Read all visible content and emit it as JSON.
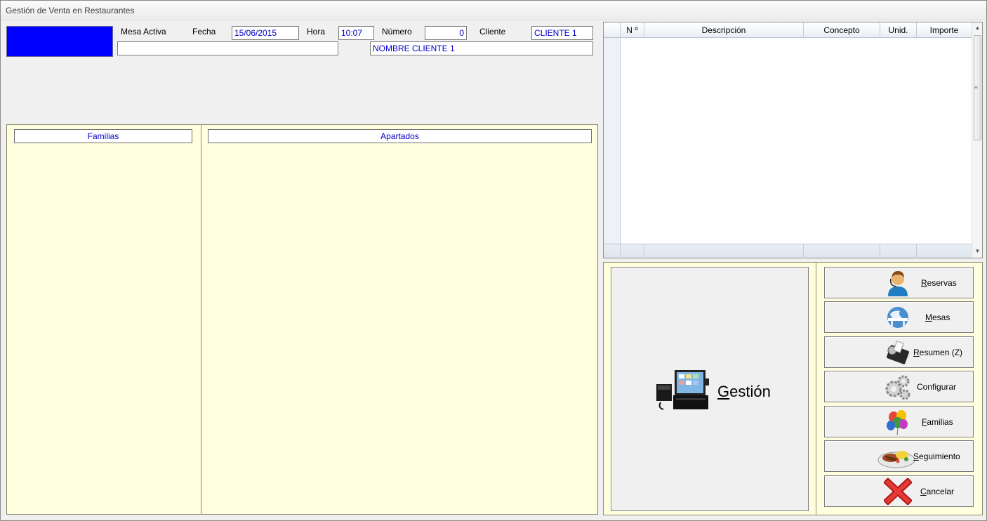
{
  "window": {
    "title": "Gestión de Venta en Restaurantes"
  },
  "colors": {
    "accent": "#0000ff",
    "panel_bg": "#ffffe0",
    "field_text": "#0000cc"
  },
  "header": {
    "mesa_activa_label": "Mesa Activa",
    "mesa_activa_value": "",
    "fecha_label": "Fecha",
    "fecha_value": "15/06/2015",
    "hora_label": "Hora",
    "hora_value": "10:07",
    "numero_label": "Número",
    "numero_value": "0",
    "cliente_label": "Cliente",
    "cliente_value": "CLIENTE 1",
    "cliente_nombre": "NOMBRE CLIENTE 1"
  },
  "familias": {
    "header": "Familias"
  },
  "apartados": {
    "header": "Apartados"
  },
  "grid": {
    "columns": [
      "N º",
      "Descripción",
      "Concepto",
      "Unid.",
      "Importe"
    ],
    "rows": []
  },
  "main_button": {
    "label_mnemonic": "G",
    "label_rest": "estión",
    "icon": "pos-terminal-icon"
  },
  "side_buttons": [
    {
      "mnemonic": "R",
      "rest": "eservas",
      "icon": "receptionist-icon"
    },
    {
      "mnemonic": "M",
      "rest": "esas",
      "icon": "globe-table-icon"
    },
    {
      "mnemonic": "R",
      "rest": "esumen (Z)",
      "icon": "receipt-printer-icon"
    },
    {
      "mnemonic": "",
      "rest": "Configurar",
      "icon": "gears-icon"
    },
    {
      "mnemonic": "F",
      "rest": "amilias",
      "icon": "balloons-icon"
    },
    {
      "mnemonic": "S",
      "rest": "eguimiento",
      "icon": "food-plate-icon"
    },
    {
      "mnemonic": "C",
      "rest": "ancelar",
      "icon": "red-x-icon"
    }
  ]
}
